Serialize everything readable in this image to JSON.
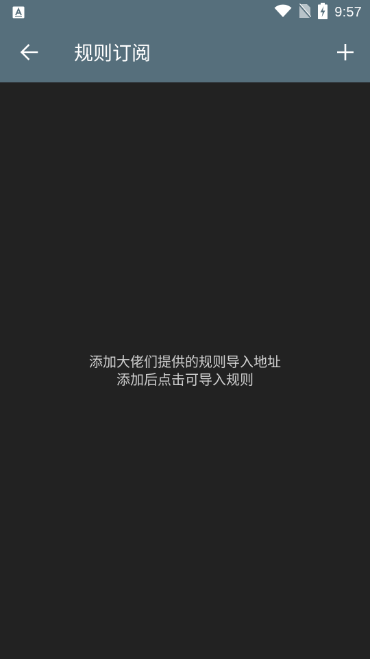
{
  "status_bar": {
    "time": "9:57",
    "icons": [
      "accessibility-a-icon",
      "wifi-icon",
      "no-sim-icon",
      "battery-charging-icon"
    ]
  },
  "toolbar": {
    "title": "规则订阅",
    "back_icon": "arrow-left-icon",
    "add_icon": "plus-icon"
  },
  "empty_state": {
    "line1": "添加大佬们提供的规则导入地址",
    "line2": "添加后点击可导入规则"
  },
  "colors": {
    "toolbar_bg": "#566f7c",
    "content_bg": "#222222",
    "text_primary": "#ffffff",
    "text_secondary": "#cfcfcf"
  }
}
